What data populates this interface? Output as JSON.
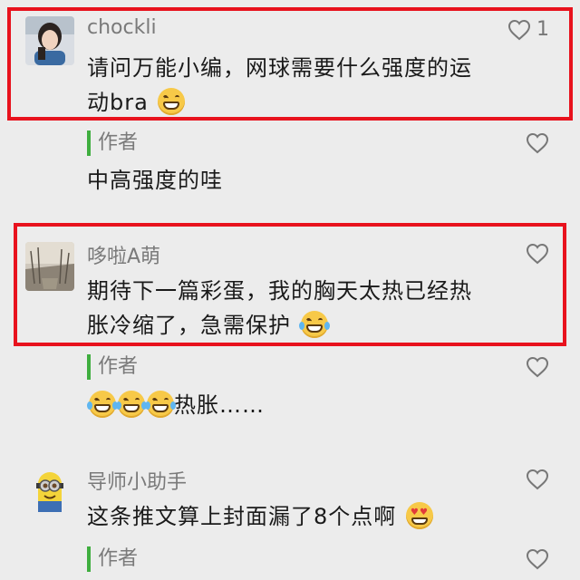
{
  "comments": [
    {
      "name": "chockli",
      "text": "请问万能小编，网球需要什么强度的运动bra",
      "text_line1": "请问万能小编，网球需要什么强度的运",
      "text_line2": "动bra",
      "emoji": "grin-emoji",
      "likes": "1",
      "reply_label": "作者",
      "reply": "中高强度的哇"
    },
    {
      "name": "哆啦A萌",
      "text_line1": "期待下一篇彩蛋，我的胸天太热已经热",
      "text_line2": "胀冷缩了，急需保护",
      "emoji": "laugh-cry-emoji",
      "reply_label": "作者",
      "reply": "热胀……"
    },
    {
      "name": "导师小助手",
      "text": "这条推文算上封面漏了8个点啊",
      "emoji": "heart-eyes-emoji",
      "reply_label": "作者"
    }
  ],
  "colors": {
    "highlight_border": "#e8121d",
    "author_bar": "#3fae3f",
    "background": "#ececec"
  },
  "icons": [
    "heart-outline-icon"
  ]
}
